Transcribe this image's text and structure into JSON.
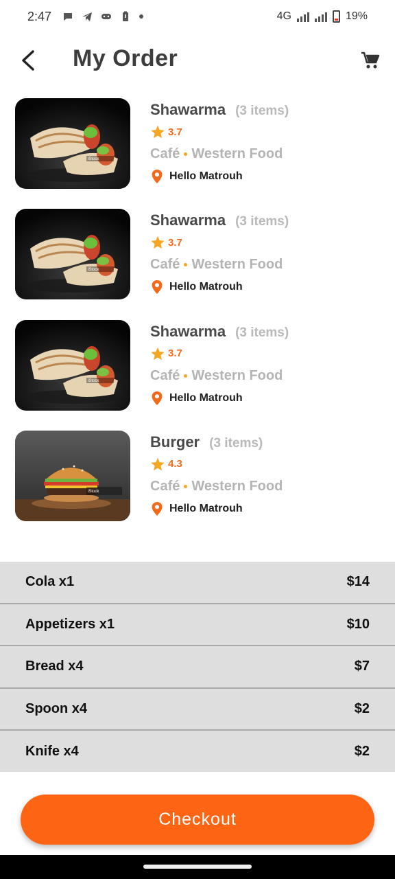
{
  "status_bar": {
    "time": "2:47",
    "network": "4G",
    "battery": "19%",
    "icons": [
      "chat-bubble-icon",
      "telegram-icon",
      "game-controller-icon",
      "battery-saver-icon",
      "dot-icon"
    ]
  },
  "header": {
    "title": "My Order",
    "back_icon": "chevron-left-icon",
    "cart_icon": "cart-icon"
  },
  "restaurants": [
    {
      "name": "Shawarma",
      "items": "(3 items)",
      "rating": "3.7",
      "category": "Café",
      "cuisine": "Western Food",
      "location": "Hello Matrouh",
      "image": "shawarma"
    },
    {
      "name": "Shawarma",
      "items": "(3 items)",
      "rating": "3.7",
      "category": "Café",
      "cuisine": "Western Food",
      "location": "Hello Matrouh",
      "image": "shawarma"
    },
    {
      "name": "Shawarma",
      "items": "(3 items)",
      "rating": "3.7",
      "category": "Café",
      "cuisine": "Western Food",
      "location": "Hello Matrouh",
      "image": "shawarma"
    },
    {
      "name": "Burger",
      "items": "(3 items)",
      "rating": "4.3",
      "category": "Café",
      "cuisine": "Western Food",
      "location": "Hello Matrouh",
      "image": "burger"
    }
  ],
  "order_items": [
    {
      "name": "Cola x1",
      "price": "$14"
    },
    {
      "name": "Appetizers x1",
      "price": "$10"
    },
    {
      "name": "Bread x4",
      "price": "$7"
    },
    {
      "name": "Spoon x4",
      "price": "$2"
    },
    {
      "name": "Knife x4",
      "price": "$2"
    }
  ],
  "checkout": {
    "label": "Checkout"
  },
  "colors": {
    "accent": "#FD6413",
    "rating": "#F26A1B",
    "star": "#F5A623",
    "row_bg": "#DEDEDE"
  }
}
